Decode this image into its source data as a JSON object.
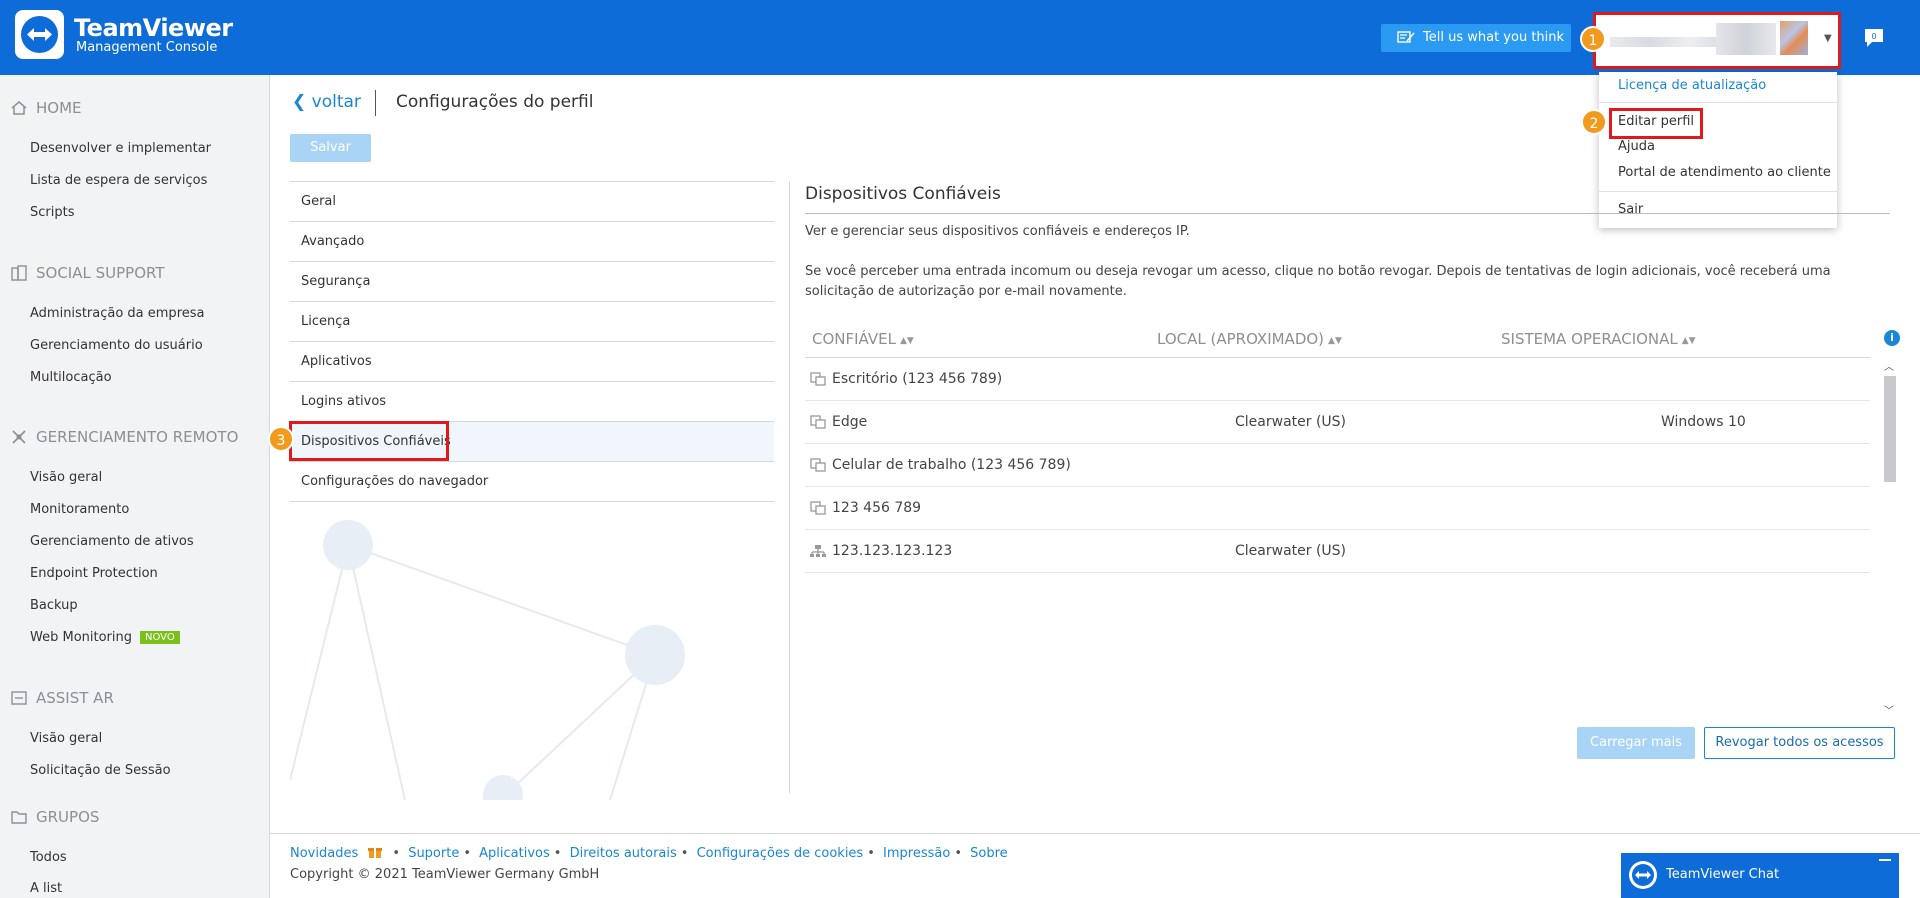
{
  "header": {
    "brand_title": "TeamViewer",
    "brand_subtitle": "Management Console",
    "feedback_label": "Tell us what you think",
    "notification_count": "0"
  },
  "steps": [
    "1",
    "2",
    "3"
  ],
  "user_menu": {
    "items": [
      "Licença de atualização",
      "Editar perfil",
      "Ajuda",
      "Portal de atendimento ao cliente",
      "Sair"
    ]
  },
  "sidebar": {
    "sections": [
      {
        "title": "HOME",
        "items": [
          "Desenvolver e implementar",
          "Lista de espera de serviços",
          "Scripts"
        ]
      },
      {
        "title": "SOCIAL SUPPORT",
        "items": [
          "Administração da empresa",
          "Gerenciamento do usuário",
          "Multilocação"
        ]
      },
      {
        "title": "GERENCIAMENTO REMOTO",
        "items": [
          "Visão geral",
          "Monitoramento",
          "Gerenciamento de ativos",
          "Endpoint Protection",
          "Backup",
          "Web Monitoring"
        ]
      },
      {
        "title": "ASSIST AR",
        "items": [
          "Visão geral",
          "Solicitação de Sessão"
        ]
      },
      {
        "title": "GRUPOS",
        "items": [
          "Todos",
          "A list"
        ]
      }
    ],
    "new_badge": "NOVO"
  },
  "main": {
    "back_label": "voltar",
    "page_title": "Configurações do perfil",
    "save_label": "Salvar",
    "nav": [
      "Geral",
      "Avançado",
      "Segurança",
      "Licença",
      "Aplicativos",
      "Logins ativos",
      "Dispositivos Confiáveis",
      "Configurações do navegador"
    ]
  },
  "panel": {
    "title": "Dispositivos Confiáveis",
    "desc1": "Ver e gerenciar seus dispositivos confiáveis e endereços IP.",
    "desc2": "Se você perceber uma entrada incomum ou deseja revogar um acesso, clique no botão revogar. Depois de tentativas de login adicionais, você receberá uma solicitação de autorização por e-mail novamente.",
    "columns": [
      "CONFIÁVEL",
      "LOCAL (APROXIMADO)",
      "SISTEMA OPERACIONAL"
    ],
    "rows": [
      {
        "name": "Escritório (123 456 789)",
        "location": "",
        "os": ""
      },
      {
        "name": "Edge",
        "location": "Clearwater (US)",
        "os": "Windows 10"
      },
      {
        "name": "Celular de trabalho (123 456 789)",
        "location": "",
        "os": ""
      },
      {
        "name": "123 456 789",
        "location": "",
        "os": ""
      },
      {
        "name": "123.123.123.123",
        "location": "Clearwater (US)",
        "os": ""
      }
    ],
    "load_more_label": "Carregar mais",
    "revoke_all_label": "Revogar todos os acessos"
  },
  "footer": {
    "links": [
      "Novidades",
      "Suporte",
      "Aplicativos",
      "Direitos autorais",
      "Configurações de cookies",
      "Impressão",
      "Sobre"
    ],
    "copyright": "Copyright © 2021 TeamViewer Germany GmbH"
  },
  "chat": {
    "label": "TeamViewer Chat"
  },
  "colors": {
    "brand": "#0e6cd8",
    "link": "#1a86d6",
    "highlight": "#e01a1a",
    "step_badge": "#f29a1d",
    "new_badge": "#7bc01a"
  }
}
